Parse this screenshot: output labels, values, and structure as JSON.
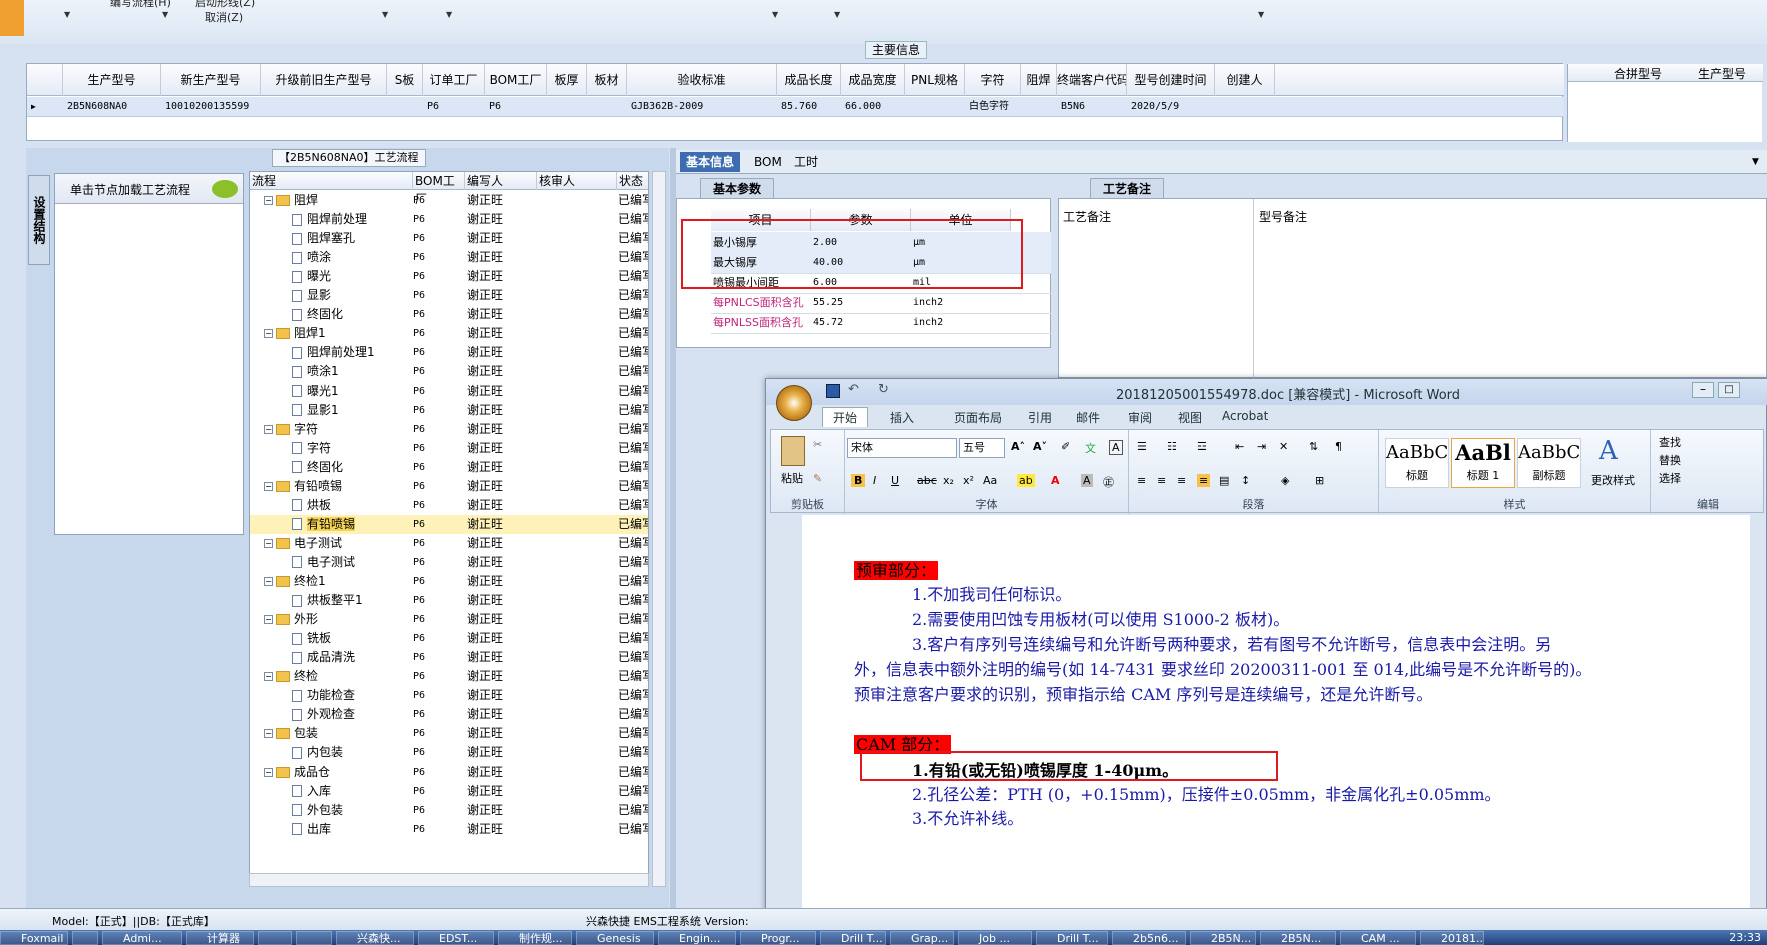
{
  "toolbar": {
    "item1": "编写流程(H)",
    "item2": "启动形线(Z)",
    "cancel": "取消(Z)"
  },
  "main_info": {
    "title": "主要信息",
    "columns": [
      "生产型号",
      "新生产型号",
      "升级前旧生产型号",
      "S板",
      "订单工厂",
      "BOM工厂",
      "板厚",
      "板材",
      "验收标准",
      "成品长度",
      "成品宽度",
      "PNL规格",
      "字符",
      "阻焊",
      "终端客户代码",
      "型号创建时间",
      "创建人"
    ],
    "row": [
      "2B5N608NA0",
      "10010200135599",
      "",
      "",
      "P6",
      "P6",
      "",
      "",
      "GJB362B-2009",
      "85.760",
      "66.000",
      "",
      "白色字符",
      "",
      "B5N6",
      "2020/5/9",
      ""
    ],
    "right_columns": [
      "合拼型号",
      "生产型号"
    ]
  },
  "process": {
    "title": "【2B5N608NA0】工艺流程",
    "vertical_tab": "设置结构",
    "load_text": "单击节点加载工艺流程",
    "columns": [
      "流程",
      "BOM工厂",
      "编写人",
      "核审人",
      "状态"
    ],
    "rows": [
      {
        "name": "阻焊",
        "type": "folder",
        "bom": "P6",
        "writer": "谢正旺",
        "status": "已编写"
      },
      {
        "name": "阻焊前处理",
        "type": "item",
        "bom": "P6",
        "writer": "谢正旺",
        "status": "已编写"
      },
      {
        "name": "阻焊塞孔",
        "type": "item",
        "bom": "P6",
        "writer": "谢正旺",
        "status": "已编写"
      },
      {
        "name": "喷涂",
        "type": "item",
        "bom": "P6",
        "writer": "谢正旺",
        "status": "已编写"
      },
      {
        "name": "曝光",
        "type": "item",
        "bom": "P6",
        "writer": "谢正旺",
        "status": "已编写"
      },
      {
        "name": "显影",
        "type": "item",
        "bom": "P6",
        "writer": "谢正旺",
        "status": "已编写"
      },
      {
        "name": "终固化",
        "type": "item",
        "bom": "P6",
        "writer": "谢正旺",
        "status": "已编写"
      },
      {
        "name": "阻焊1",
        "type": "folder",
        "bom": "P6",
        "writer": "谢正旺",
        "status": "已编写"
      },
      {
        "name": "阻焊前处理1",
        "type": "item",
        "bom": "P6",
        "writer": "谢正旺",
        "status": "已编写"
      },
      {
        "name": "喷涂1",
        "type": "item",
        "bom": "P6",
        "writer": "谢正旺",
        "status": "已编写"
      },
      {
        "name": "曝光1",
        "type": "item",
        "bom": "P6",
        "writer": "谢正旺",
        "status": "已编写"
      },
      {
        "name": "显影1",
        "type": "item",
        "bom": "P6",
        "writer": "谢正旺",
        "status": "已编写"
      },
      {
        "name": "字符",
        "type": "folder",
        "bom": "P6",
        "writer": "谢正旺",
        "status": "已编写"
      },
      {
        "name": "字符",
        "type": "item",
        "bom": "P6",
        "writer": "谢正旺",
        "status": "已编写"
      },
      {
        "name": "终固化",
        "type": "item",
        "bom": "P6",
        "writer": "谢正旺",
        "status": "已编写"
      },
      {
        "name": "有铅喷锡",
        "type": "folder",
        "bom": "P6",
        "writer": "谢正旺",
        "status": "已编写"
      },
      {
        "name": "烘板",
        "type": "item",
        "bom": "P6",
        "writer": "谢正旺",
        "status": "已编写"
      },
      {
        "name": "有铅喷锡",
        "type": "item",
        "bom": "P6",
        "writer": "谢正旺",
        "status": "已编写",
        "selected": true
      },
      {
        "name": "电子测试",
        "type": "folder",
        "bom": "P6",
        "writer": "谢正旺",
        "status": "已编写"
      },
      {
        "name": "电子测试",
        "type": "item",
        "bom": "P6",
        "writer": "谢正旺",
        "status": "已编写"
      },
      {
        "name": "终检1",
        "type": "folder",
        "bom": "P6",
        "writer": "谢正旺",
        "status": "已编写"
      },
      {
        "name": "烘板整平1",
        "type": "item",
        "bom": "P6",
        "writer": "谢正旺",
        "status": "已编写"
      },
      {
        "name": "外形",
        "type": "folder",
        "bom": "P6",
        "writer": "谢正旺",
        "status": "已编写"
      },
      {
        "name": "铣板",
        "type": "item",
        "bom": "P6",
        "writer": "谢正旺",
        "status": "已编写"
      },
      {
        "name": "成品清洗",
        "type": "item",
        "bom": "P6",
        "writer": "谢正旺",
        "status": "已编写"
      },
      {
        "name": "终检",
        "type": "folder",
        "bom": "P6",
        "writer": "谢正旺",
        "status": "已编写"
      },
      {
        "name": "功能检查",
        "type": "item",
        "bom": "P6",
        "writer": "谢正旺",
        "status": "已编写"
      },
      {
        "name": "外观检查",
        "type": "item",
        "bom": "P6",
        "writer": "谢正旺",
        "status": "已编写"
      },
      {
        "name": "包装",
        "type": "folder",
        "bom": "P6",
        "writer": "谢正旺",
        "status": "已编写"
      },
      {
        "name": "内包装",
        "type": "item",
        "bom": "P6",
        "writer": "谢正旺",
        "status": "已编写"
      },
      {
        "name": "成品仓",
        "type": "folder",
        "bom": "P6",
        "writer": "谢正旺",
        "status": "已编写"
      },
      {
        "name": "入库",
        "type": "item",
        "bom": "P6",
        "writer": "谢正旺",
        "status": "已编写"
      },
      {
        "name": "外包装",
        "type": "item",
        "bom": "P6",
        "writer": "谢正旺",
        "status": "已编写"
      },
      {
        "name": "出库",
        "type": "item",
        "bom": "P6",
        "writer": "谢正旺",
        "status": "已编写"
      }
    ]
  },
  "right_tabs": [
    "基本信息",
    "BOM",
    "工时"
  ],
  "basic_params": {
    "tab": "基本参数",
    "columns": [
      "项目",
      "参数",
      "单位"
    ],
    "rows": [
      {
        "item": "最小锡厚",
        "value": "2.00",
        "unit": "μm"
      },
      {
        "item": "最大锡厚",
        "value": "40.00",
        "unit": "μm"
      },
      {
        "item": "喷锡最小间距",
        "value": "6.00",
        "unit": "mil"
      },
      {
        "item": "每PNLCS面积含孔",
        "value": "55.25",
        "unit": "inch2"
      },
      {
        "item": "每PNLSS面积含孔",
        "value": "45.72",
        "unit": "inch2"
      }
    ]
  },
  "notes": {
    "tab": "工艺备注",
    "col1": "工艺备注",
    "col2": "型号备注"
  },
  "word": {
    "title": "20181205001554978.doc [兼容模式] - Microsoft Word",
    "tabs": [
      "开始",
      "插入",
      "页面布局",
      "引用",
      "邮件",
      "审阅",
      "视图",
      "Acrobat"
    ],
    "clipboard": "剪贴板",
    "paste": "粘贴",
    "font_name": "宋体",
    "font_size": "五号",
    "font_group": "字体",
    "paragraph_group": "段落",
    "styles_group": "样式",
    "edit_group": "编辑",
    "styles": [
      {
        "preview": "AaBbC",
        "label": "标题"
      },
      {
        "preview": "AaBl",
        "label": "标题 1"
      },
      {
        "preview": "AaBbC",
        "label": "副标题"
      }
    ],
    "change_styles": "更改样式",
    "find": "查找",
    "replace": "替换",
    "select": "选择",
    "pre_header": "预审部分：",
    "pre_lines": [
      "1.不加我司任何标识。",
      "2.需要使用凹蚀专用板材(可以使用 S1000-2 板材)。",
      "3.客户有序列号连续编号和允许断号两种要求，若有图号不允许断号，信息表中会注明。另",
      "外，信息表中额外注明的编号(如 14-7431 要求丝印 20200311-001 至 014,此编号是不允许断号的)。",
      "预审注意客户要求的识别，预审指示给 CAM 序列号是连续编号，还是允许断号。"
    ],
    "cam_header": "CAM 部分：",
    "cam_lines": [
      "1.有铅(或无铅)喷锡厚度 1-40μm。",
      "2.孔径公差：PTH (0，+0.15mm)，压接件±0.05mm，非金属化孔±0.05mm。",
      "3.不允许补线。"
    ]
  },
  "status": {
    "model": "Model:【正式】||DB:【正式库】",
    "app": "兴森快捷 EMS工程系统 Version:"
  },
  "taskbar": {
    "items": [
      "Foxmail",
      "",
      "Admi...",
      "计算器",
      "",
      "",
      "兴森快...",
      "EDST...",
      "制作规...",
      "Genesis",
      "Engin...",
      "Progr...",
      "Drill T...",
      "Grap...",
      "Job ...",
      "Drill T...",
      "2b5n6...",
      "2B5N...",
      "2B5N...",
      "CAM ...",
      "20181..."
    ],
    "clock": "23:33"
  }
}
